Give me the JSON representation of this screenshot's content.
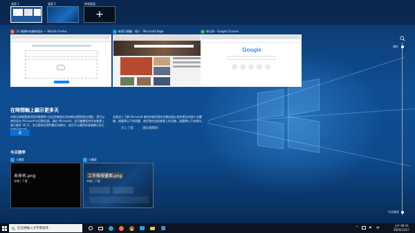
{
  "desktops": [
    {
      "label": "桌面 1",
      "active": true
    },
    {
      "label": "桌面 2",
      "active": false
    },
    {
      "label": "新增桌面",
      "active": false,
      "plus": "+"
    }
  ],
  "windows": [
    {
      "title": "(3) 鷹裡布老最新版本 — Mozilla Firefox",
      "app": "firefox-icon",
      "color": "#ff7139"
    },
    {
      "title": "新索引標籤 - 個人 - Microsoft Edge",
      "app": "edge-icon",
      "color": "#1fa3e0"
    },
    {
      "title": "新分頁 - Google Chrome",
      "app": "chrome-icon",
      "color": "#4caf50"
    }
  ],
  "chrome_page": {
    "logo": "Google"
  },
  "timeline": {
    "heading": "在時間軸上顯示更多天",
    "description": "如果在跨裝置使用您的裝置時 (包括您曾經在您的網站瀏覽過的活動)，您可以使用您在 Microsoft 的活動記錄，讓在 Microsoft，並可繼續您的所有裝置上進行最多 30 天，並且能夠在我們最近的動作，這些可以讓您快速接續之前正在進行的工作。",
    "description2": "若要深入了解 Microsoft 會如何使用我的活動記錄以提供更佳的個人化體驗，請選擇以下的頁籤，使用我在這部裝置上的活動，請選擇以下的操作。",
    "yes_button": "是",
    "links": [
      "深入了解",
      "隱私權聲明"
    ]
  },
  "today": {
    "heading": "今天稍早",
    "activities": [
      {
        "app": "小畫家",
        "filename": "未命名.png",
        "sub": "本機 | 下載"
      },
      {
        "app": "小畫家",
        "filename": "工作檢視畫面.png",
        "sub": "本機 | 下載"
      }
    ]
  },
  "slider": {
    "top_label": "現在",
    "bottom_label": "今天稍早"
  },
  "taskbar": {
    "search_placeholder": "在這裡輸入文字來搜尋",
    "time": "上午 09:31",
    "date": "2020/12/27",
    "lang": "中",
    "pinned": [
      {
        "name": "cortana-icon",
        "color": "#ffffff"
      },
      {
        "name": "taskview-icon",
        "color": "#ffffff"
      },
      {
        "name": "edge-icon",
        "color": "#1fa3e0"
      },
      {
        "name": "firefox-icon",
        "color": "#ff7139"
      },
      {
        "name": "chrome-icon",
        "color": "#4caf50"
      },
      {
        "name": "paint-icon",
        "color": "#2aa0e8"
      },
      {
        "name": "explorer-icon",
        "color": "#f4c04e"
      },
      {
        "name": "store-icon",
        "color": "#3d8fd6"
      }
    ]
  }
}
